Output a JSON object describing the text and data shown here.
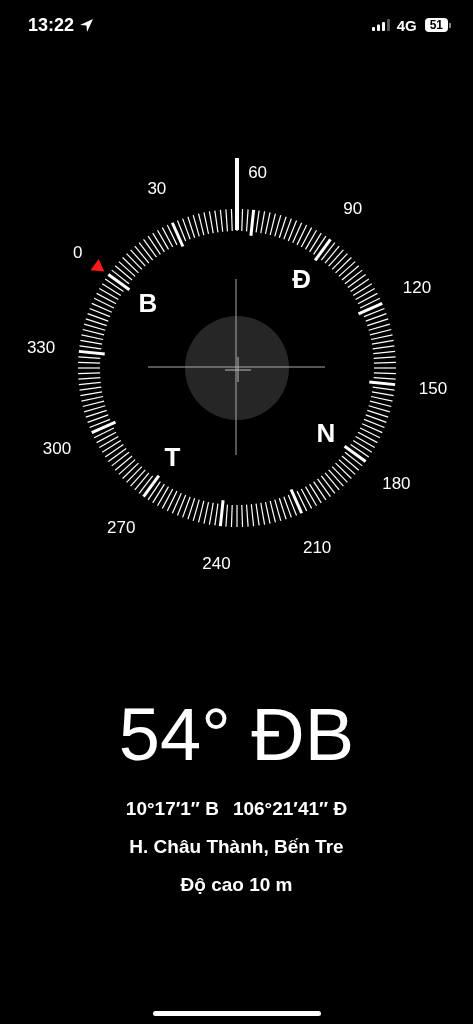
{
  "status_bar": {
    "time": "13:22",
    "network": "4G",
    "battery": "51"
  },
  "compass": {
    "degree_labels": [
      "0",
      "30",
      "60",
      "90",
      "120",
      "150",
      "180",
      "210",
      "240",
      "270",
      "300",
      "330"
    ],
    "cardinals": [
      "B",
      "Đ",
      "N",
      "T"
    ]
  },
  "heading": "54° ĐB",
  "coordinates": {
    "latitude": "10°17′1″ B",
    "longitude": "106°21′41″ Đ"
  },
  "location": "H. Châu Thành, Bến Tre",
  "elevation": "Độ cao 10 m"
}
